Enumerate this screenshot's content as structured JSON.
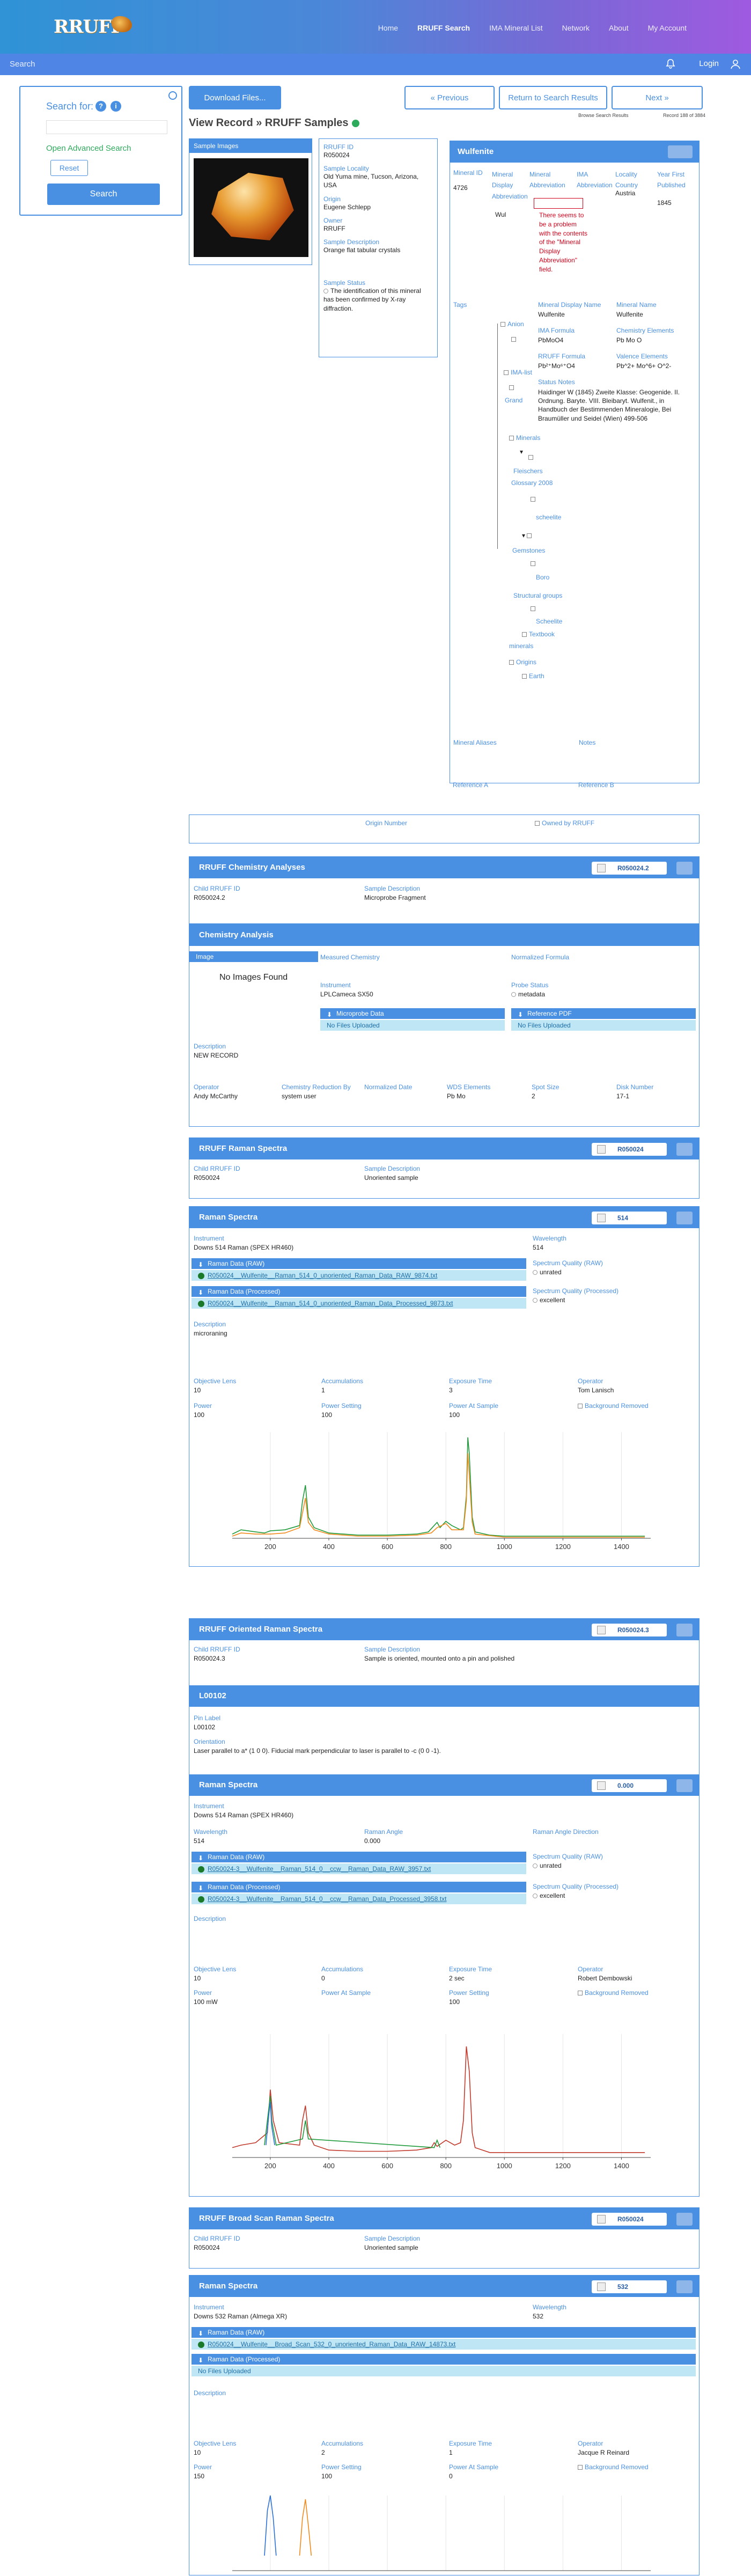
{
  "header": {
    "logo_text": "RRUFF",
    "nav": [
      "Home",
      "RRUFF Search",
      "IMA Mineral List",
      "Network",
      "About",
      "My Account"
    ],
    "search_label": "Search",
    "login": "Login"
  },
  "sidebar": {
    "search_for": "Search for:",
    "help": "?",
    "info": "i",
    "advanced": "Open Advanced Search",
    "reset": "Reset",
    "search_button": "Search"
  },
  "toolbar": {
    "download": "Download Files...",
    "previous": "« Previous",
    "return": "Return to Search Results",
    "next": "Next »",
    "browse_meta": "Browse Search Results",
    "record_meta": "Record 188 of 3884"
  },
  "view": {
    "title": "View Record » RRUFF Samples",
    "images_label": "Sample Images"
  },
  "sample": {
    "rruff_id_label": "RRUFF ID",
    "rruff_id": "R050024",
    "locality_label": "Sample Locality",
    "locality": "Old Yuma mine, Tucson, Arizona, USA",
    "origin_label": "Origin",
    "origin": "Eugene Schlepp",
    "owner_label": "Owner",
    "owner": "RRUFF",
    "desc_label": "Sample Description",
    "desc": "Orange flat tabular crystals",
    "status_label": "Sample Status",
    "status": "The identification of this mineral has been confirmed by X-ray diffraction."
  },
  "mineral": {
    "name": "Wulfenite",
    "id_label": "Mineral ID",
    "id": "4726",
    "display_label": "Mineral Display Abbreviation",
    "display": "Wul",
    "abbr_label": "Mineral Abbreviation",
    "abbr_error": "There seems to be a problem with the contents of the \"Mineral Display Abbreviation\" field.",
    "ima_abbr_label": "IMA Abbreviation",
    "ima_abbr": "Wul",
    "locality_label": "Locality Country",
    "locality": "Austria",
    "year_label": "Year First Published",
    "year": "1845",
    "tags_label": "Tags",
    "display_name_label": "Mineral Display Name",
    "display_name": "Wulfenite",
    "mineral_name_label": "Mineral Name",
    "mineral_name": "Wulfenite",
    "ima_formula_label": "IMA Formula",
    "ima_formula": "PbMoO4",
    "chem_label": "Chemistry Elements",
    "chem": "Pb Mo O",
    "rruff_formula_label": "RRUFF Formula",
    "rruff_formula": "Pb²⁺Mo⁶⁺O4",
    "valence_label": "Valence Elements",
    "valence": "Pb^2+ Mo^6+ O^2-",
    "status_notes_label": "Status Notes",
    "status_notes": "Haidinger W (1845) Zweite Klasse: Geogenide. II. Ordnung. Baryte. VIII. Bleibaryt. Wulfenit., in Handbuch der Bestimmenden Mineralogie, Bei Braumüller und Seidel (Wien) 499-506",
    "tree": [
      "Anion",
      "IMA-list",
      "Grand",
      "Minerals",
      "Fleischers",
      "Glossary 2008",
      "scheelite",
      "Groups",
      "Gemstones",
      "Boro",
      "Structural groups",
      "Scheelite",
      "Textbook",
      "minerals",
      "Origins",
      "Earth"
    ],
    "aliases_label": "Mineral Aliases",
    "notes_label": "Notes",
    "ref_a": "Reference A",
    "ref_b": "Reference B"
  },
  "origin_row": {
    "origin_number": "Origin Number",
    "owned": "Owned by RRUFF"
  },
  "chem_analyses": {
    "title": "RRUFF Chemistry Analyses",
    "pill": "R050024.2",
    "child_label": "Child RRUFF ID",
    "child": "R050024.2",
    "desc_label": "Sample Description",
    "desc": "Microprobe Fragment"
  },
  "chem_analysis": {
    "title": "Chemistry Analysis",
    "image_label": "Image",
    "no_images": "No Images Found",
    "measured_label": "Measured Chemistry",
    "normalized_label": "Normalized Formula",
    "instrument_label": "Instrument",
    "instrument": "LPLCameca SX50",
    "probe_label": "Probe Status",
    "probe": "metadata",
    "micro_btn": "Microprobe Data",
    "ref_btn": "Reference PDF",
    "no_files": "No Files Uploaded",
    "no_files2": "No Files Uploaded",
    "desc_label": "Description",
    "desc": "NEW RECORD",
    "operator_label": "Operator",
    "operator": "Andy McCarthy",
    "reduction_label": "Chemistry Reduction By",
    "reduction": "system user",
    "normdate_label": "Normalized Date",
    "wds_label": "WDS Elements",
    "wds": "Pb Mo",
    "spot_label": "Spot Size",
    "spot": "2",
    "disk_label": "Disk Number",
    "disk": "17-1"
  },
  "raman": {
    "title": "RRUFF Raman Spectra",
    "pill": "R050024",
    "child_label": "Child RRUFF ID",
    "child": "R050024",
    "desc_label": "Sample Description",
    "desc": "Unoriented sample",
    "sub_title": "Raman Spectra",
    "sub_pill": "514",
    "instrument_label": "Instrument",
    "instrument": "Downs 514 Raman (SPEX HR460)",
    "wave_label": "Wavelength",
    "wave": "514",
    "raw_btn": "Raman Data (RAW)",
    "raw_file": "R050024__Wulfenite__Raman_514_0_unoriented_Raman_Data_RAW_9874.txt",
    "q_raw_label": "Spectrum Quality (RAW)",
    "q_raw": "unrated",
    "proc_btn": "Raman Data (Processed)",
    "proc_file": "R050024__Wulfenite__Raman_514_0_unoriented_Raman_Data_Processed_9873.txt",
    "q_proc_label": "Spectrum Quality (Processed)",
    "q_proc": "excellent",
    "desc2_label": "Description",
    "desc2": "microraning",
    "obj_label": "Objective Lens",
    "obj": "10",
    "acc_label": "Accumulations",
    "acc": "1",
    "exp_label": "Exposure Time",
    "exp": "3",
    "op_label": "Operator",
    "op": "Tom Lanisch",
    "power_label": "Power",
    "power": "100",
    "pset_label": "Power Setting",
    "pset": "100",
    "psample_label": "Power At Sample",
    "psample": "100",
    "bg_label": "Background Removed"
  },
  "oriented": {
    "title": "RRUFF Oriented Raman Spectra",
    "pill": "R050024.3",
    "child_label": "Child RRUFF ID",
    "child": "R050024.3",
    "desc_label": "Sample Description",
    "desc": "Sample is oriented, mounted onto a pin and polished",
    "l_title": "L00102",
    "pin_label": "Pin Label",
    "pin": "L00102",
    "orient_label": "Orientation",
    "orient": "Laser parallel to a* (1 0 0). Fiducial mark perpendicular to laser is parallel to -c (0 0 -1).",
    "sub_title": "Raman Spectra",
    "sub_pill": "0.000",
    "instrument_label": "Instrument",
    "instrument": "Downs 514 Raman (SPEX HR460)",
    "wave_label": "Wavelength",
    "wave": "514",
    "angle_label": "Raman Angle",
    "angle": "0.000",
    "adir_label": "Raman Angle Direction",
    "raw_btn": "Raman Data (RAW)",
    "raw_file": "R050024-3__Wulfenite__Raman_514_0__ccw__Raman_Data_RAW_3957.txt",
    "q_raw_label": "Spectrum Quality (RAW)",
    "q_raw": "unrated",
    "proc_btn": "Raman Data (Processed)",
    "proc_file": "R050024-3__Wulfenite__Raman_514_0__ccw__Raman_Data_Processed_3958.txt",
    "q_proc_label": "Spectrum Quality (Processed)",
    "q_proc": "excellent",
    "desc2_label": "Description",
    "obj_label": "Objective Lens",
    "obj": "10",
    "acc_label": "Accumulations",
    "acc": "0",
    "exp_label": "Exposure Time",
    "exp": "2 sec",
    "op_label": "Operator",
    "op": "Robert Dembowski",
    "power_label": "Power",
    "power": "100 mW",
    "psample_label": "Power At Sample",
    "pset_label": "Power Setting",
    "pset": "100",
    "bg_label": "Background Removed"
  },
  "broad": {
    "title": "RRUFF Broad Scan Raman Spectra",
    "pill": "R050024",
    "child_label": "Child RRUFF ID",
    "child": "R050024",
    "desc_label": "Sample Description",
    "desc": "Unoriented sample",
    "sub_title": "Raman Spectra",
    "sub_pill": "532",
    "instrument_label": "Instrument",
    "instrument": "Downs 532 Raman (Almega XR)",
    "wave_label": "Wavelength",
    "wave": "532",
    "raw_btn": "Raman Data (RAW)",
    "raw_file": "R050024__Wulfenite__Broad_Scan_532_0_unoriented_Raman_Data_RAW_14873.txt",
    "proc_btn": "Raman Data (Processed)",
    "no_files": "No Files Uploaded",
    "desc2_label": "Description",
    "obj_label": "Objective Lens",
    "obj": "10",
    "acc_label": "Accumulations",
    "acc": "2",
    "exp_label": "Exposure Time",
    "exp": "1",
    "op_label": "Operator",
    "op": "Jacque R Reinard",
    "power_label": "Power",
    "power": "150",
    "pset_label": "Power Setting",
    "pset": "100",
    "psample_label": "Power At Sample",
    "psample": "0",
    "bg_label": "Background Removed"
  },
  "chart_data": [
    {
      "type": "line",
      "title": "",
      "xlabel": "",
      "ylabel": "",
      "xlim": [
        70,
        1500
      ],
      "xticks": [
        "200",
        "400",
        "600",
        "800",
        "1000",
        "1200",
        "1400"
      ],
      "grid": true,
      "series": [
        {
          "color": "#1f9a3a",
          "x": [
            70,
            100,
            150,
            180,
            200,
            250,
            300,
            310,
            320,
            330,
            350,
            380,
            400,
            500,
            600,
            700,
            740,
            760,
            770,
            780,
            800,
            820,
            850,
            860,
            870,
            875,
            880,
            890,
            900,
            950,
            1000,
            1100,
            1200,
            1300,
            1400,
            1480
          ],
          "y": [
            0.04,
            0.08,
            0.06,
            0.05,
            0.07,
            0.08,
            0.12,
            0.35,
            0.5,
            0.2,
            0.1,
            0.07,
            0.05,
            0.03,
            0.03,
            0.04,
            0.06,
            0.12,
            0.15,
            0.1,
            0.16,
            0.12,
            0.08,
            0.1,
            0.4,
            0.95,
            0.8,
            0.2,
            0.06,
            0.03,
            0.02,
            0.02,
            0.02,
            0.02,
            0.02,
            0.02
          ]
        },
        {
          "color": "#f08a1c",
          "x": [
            70,
            100,
            150,
            200,
            250,
            300,
            320,
            330,
            350,
            400,
            500,
            600,
            700,
            750,
            770,
            800,
            820,
            860,
            870,
            875,
            880,
            890,
            900,
            1000,
            1200,
            1400,
            1480
          ],
          "y": [
            0.02,
            0.05,
            0.04,
            0.04,
            0.05,
            0.1,
            0.38,
            0.15,
            0.08,
            0.04,
            0.02,
            0.02,
            0.03,
            0.05,
            0.1,
            0.14,
            0.08,
            0.08,
            0.35,
            0.8,
            0.6,
            0.15,
            0.04,
            0.01,
            0.01,
            0.01,
            0.01
          ]
        }
      ]
    },
    {
      "type": "line",
      "title": "",
      "xlabel": "",
      "ylabel": "",
      "xlim": [
        70,
        1500
      ],
      "xticks": [
        "200",
        "400",
        "600",
        "800",
        "1000",
        "1200",
        "1400"
      ],
      "grid": true,
      "series": [
        {
          "color": "#c0392b",
          "x": [
            70,
            100,
            150,
            190,
            200,
            210,
            230,
            300,
            310,
            320,
            330,
            350,
            400,
            500,
            600,
            700,
            750,
            760,
            770,
            800,
            830,
            850,
            860,
            870,
            880,
            890,
            900,
            950,
            1000,
            1100,
            1200,
            1300,
            1400,
            1480
          ],
          "y": [
            0.08,
            0.1,
            0.12,
            0.2,
            0.55,
            0.3,
            0.12,
            0.1,
            0.3,
            0.42,
            0.2,
            0.1,
            0.06,
            0.05,
            0.05,
            0.06,
            0.08,
            0.12,
            0.09,
            0.14,
            0.1,
            0.12,
            0.3,
            0.9,
            0.7,
            0.2,
            0.08,
            0.04,
            0.04,
            0.04,
            0.04,
            0.04,
            0.04,
            0.04
          ]
        },
        {
          "color": "#1f9a3a",
          "x": [
            180,
            195,
            200,
            205,
            220,
            310,
            320,
            330,
            760,
            770,
            780
          ],
          "y": [
            0.1,
            0.4,
            0.5,
            0.3,
            0.1,
            0.15,
            0.3,
            0.15,
            0.08,
            0.14,
            0.08
          ]
        },
        {
          "color": "#2a6fd6",
          "x": [
            185,
            195,
            200,
            205,
            215
          ],
          "y": [
            0.1,
            0.35,
            0.45,
            0.25,
            0.1
          ]
        }
      ]
    },
    {
      "type": "line",
      "title": "",
      "xlabel": "",
      "ylabel": "",
      "xlim": [
        70,
        1500
      ],
      "grid": true,
      "series": [
        {
          "color": "#2a6fd6",
          "x": [
            180,
            190,
            200,
            210,
            220
          ],
          "y": [
            0.2,
            0.8,
            1.0,
            0.7,
            0.2
          ]
        },
        {
          "color": "#f08a1c",
          "x": [
            300,
            310,
            320,
            330,
            340
          ],
          "y": [
            0.2,
            0.7,
            0.95,
            0.6,
            0.2
          ]
        }
      ]
    }
  ]
}
